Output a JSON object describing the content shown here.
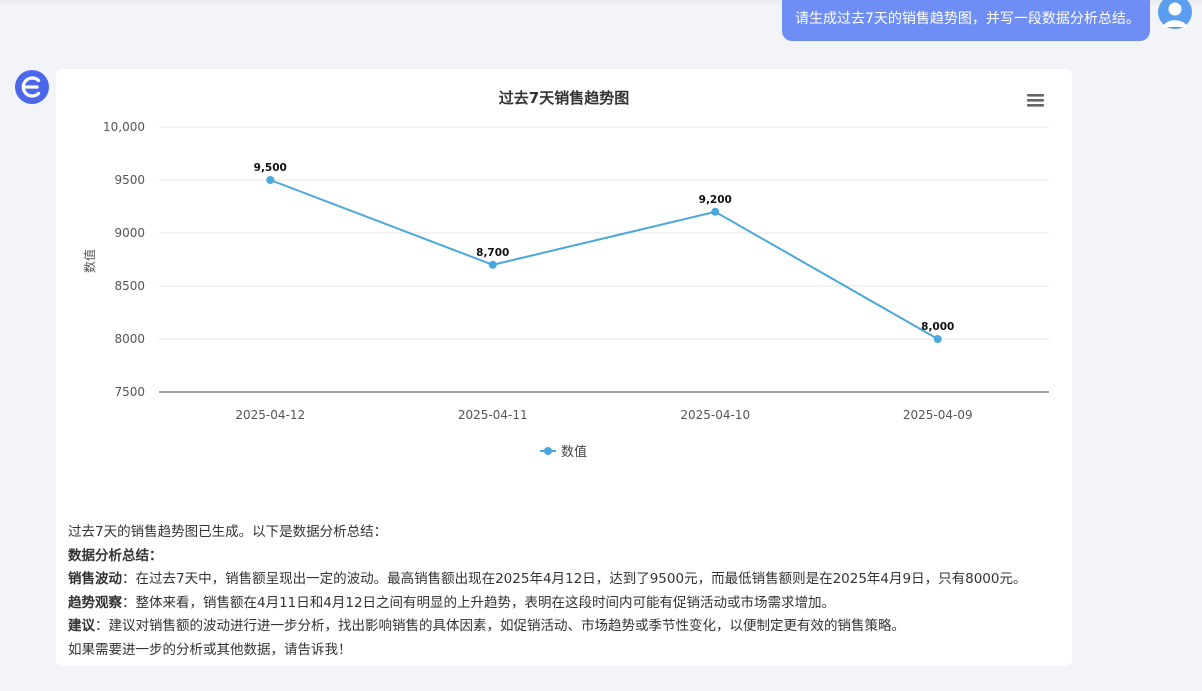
{
  "user_message": {
    "text": "请生成过去7天的销售趋势图，并写一段数据分析总结。"
  },
  "icons": {
    "bot_avatar": "assistant-logo-icon",
    "user_avatar": "user-avatar-icon",
    "chart_menu": "hamburger-menu-icon"
  },
  "colors": {
    "series": "#4aa8dc",
    "user_bubble": "#6f8ef5",
    "bot_avatar": "#4b67ea"
  },
  "chart_data": {
    "type": "line",
    "title": "过去7天销售趋势图",
    "ylabel": "数值",
    "xlabel": "",
    "categories": [
      "2025-04-12",
      "2025-04-11",
      "2025-04-10",
      "2025-04-09"
    ],
    "series": [
      {
        "name": "数值",
        "values": [
          9500,
          8700,
          9200,
          8000
        ],
        "labels": [
          "9,500",
          "8,700",
          "9,200",
          "8,000"
        ]
      }
    ],
    "ylim": [
      7500,
      10000
    ],
    "yticks": [
      "7500",
      "8000",
      "8500",
      "9000",
      "9500",
      "10,000"
    ],
    "grid": true,
    "legend_position": "bottom"
  },
  "summary": {
    "intro": "过去7天的销售趋势图已生成。以下是数据分析总结：",
    "heading": "数据分析总结：",
    "points": [
      {
        "label": "销售波动",
        "text": "：在过去7天中，销售额呈现出一定的波动。最高销售额出现在2025年4月12日，达到了9500元，而最低销售额则是在2025年4月9日，只有8000元。"
      },
      {
        "label": "趋势观察",
        "text": "：整体来看，销售额在4月11日和4月12日之间有明显的上升趋势，表明在这段时间内可能有促销活动或市场需求增加。"
      },
      {
        "label": "建议",
        "text": "：建议对销售额的波动进行进一步分析，找出影响销售的具体因素，如促销活动、市场趋势或季节性变化，以便制定更有效的销售策略。"
      }
    ],
    "closing": "如果需要进一步的分析或其他数据，请告诉我！"
  }
}
